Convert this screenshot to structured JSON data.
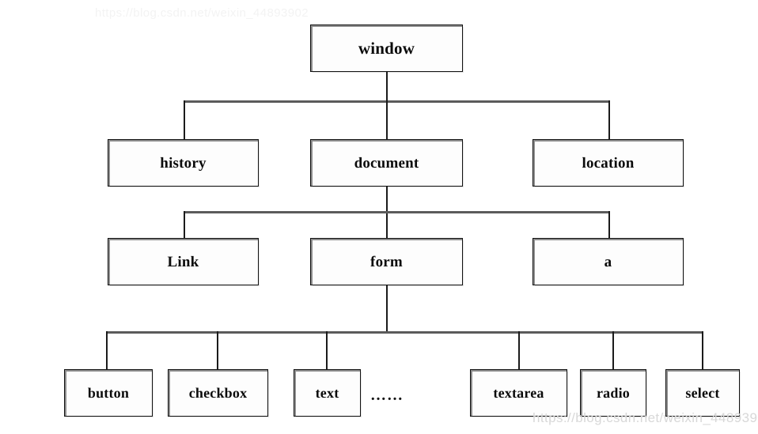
{
  "diagram": {
    "title": "BOM / DOM object hierarchy tree",
    "type": "tree",
    "background_color": "#ffffff",
    "box_border_color": "#111111",
    "box_fill_color": "#fdfdfd",
    "connector_color": "#5b5b5b",
    "levels": [
      {
        "level": 1,
        "nodes": [
          {
            "id": "window",
            "label": "window"
          }
        ]
      },
      {
        "level": 2,
        "nodes": [
          {
            "id": "history",
            "label": "history"
          },
          {
            "id": "document",
            "label": "document"
          },
          {
            "id": "location",
            "label": "location"
          }
        ]
      },
      {
        "level": 3,
        "nodes": [
          {
            "id": "link",
            "label": "Link"
          },
          {
            "id": "form",
            "label": "form"
          },
          {
            "id": "anchor",
            "label": "a"
          }
        ]
      },
      {
        "level": 4,
        "nodes": [
          {
            "id": "button",
            "label": "button"
          },
          {
            "id": "checkbox",
            "label": "checkbox"
          },
          {
            "id": "text",
            "label": "text"
          },
          {
            "id": "ellipsis",
            "label": "……"
          },
          {
            "id": "textarea",
            "label": "textarea"
          },
          {
            "id": "radio",
            "label": "radio"
          },
          {
            "id": "select",
            "label": "select"
          }
        ]
      }
    ],
    "edges": [
      {
        "from": "window",
        "to": "history"
      },
      {
        "from": "window",
        "to": "document"
      },
      {
        "from": "window",
        "to": "location"
      },
      {
        "from": "document",
        "to": "link"
      },
      {
        "from": "document",
        "to": "form"
      },
      {
        "from": "document",
        "to": "anchor"
      },
      {
        "from": "form",
        "to": "button"
      },
      {
        "from": "form",
        "to": "checkbox"
      },
      {
        "from": "form",
        "to": "text"
      },
      {
        "from": "form",
        "to": "textarea"
      },
      {
        "from": "form",
        "to": "radio"
      },
      {
        "from": "form",
        "to": "select"
      }
    ]
  },
  "watermark": {
    "url": "https://blog.csdn.net/weixin_44893902"
  }
}
